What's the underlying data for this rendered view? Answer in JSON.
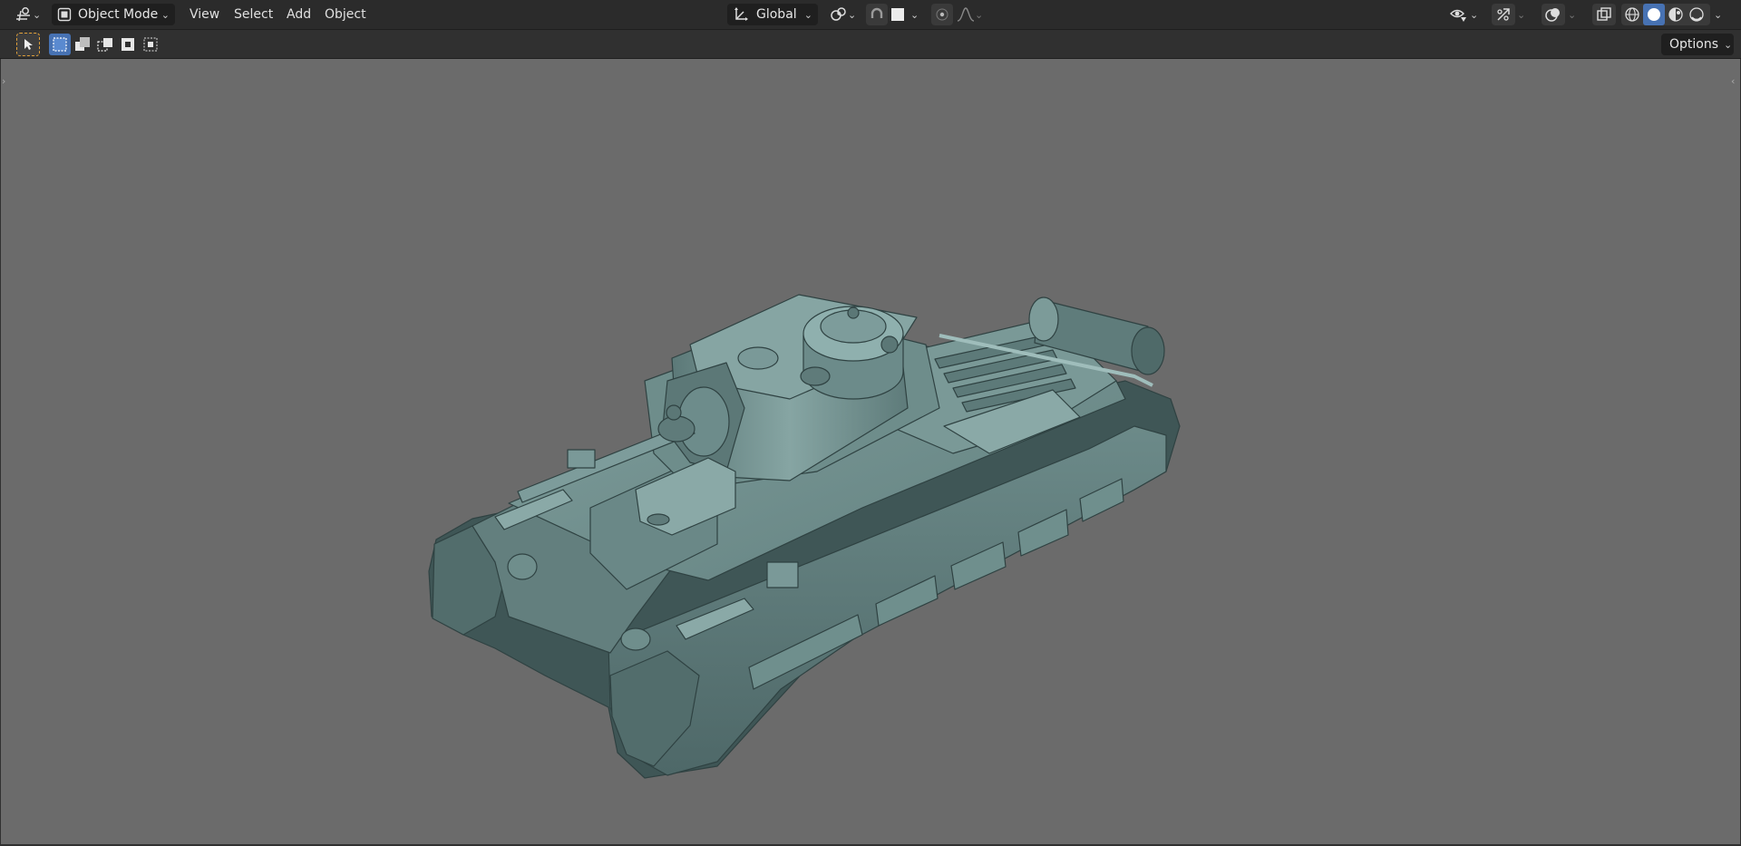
{
  "header": {
    "editor_type_icon": "3d-viewport-icon",
    "mode": {
      "label": "Object Mode",
      "icon": "object-mode-icon"
    },
    "menus": [
      "View",
      "Select",
      "Add",
      "Object"
    ],
    "transform_orientation": {
      "label": "Global",
      "icon": "transform-orientation-icon"
    },
    "pivot_icon": "pivot-point-icon",
    "snap_icon": "magnet-icon",
    "snap_target_icon": "snap-target-icon",
    "proportional_icon": "proportional-editing-icon",
    "falloff_icon": "falloff-curve-icon",
    "right_icons": [
      "visibility-icon",
      "gizmo-icon",
      "overlay-icon",
      "xray-icon"
    ],
    "shading_modes": [
      "wireframe",
      "solid",
      "material-preview",
      "rendered"
    ],
    "active_shading": "solid"
  },
  "toolbar": {
    "active_tool_icon": "select-cursor-icon",
    "selection_modes": [
      "new",
      "extend",
      "subtract",
      "invert"
    ],
    "options_label": "Options"
  },
  "viewport": {
    "background_color": "#6b6b6b",
    "subject": "tank-model"
  },
  "colors": {
    "header_bg": "#2b2b2b",
    "active_blue": "#4772b3",
    "active_tool_outline": "#e0a03a",
    "model_base": "#5f7b7a"
  }
}
